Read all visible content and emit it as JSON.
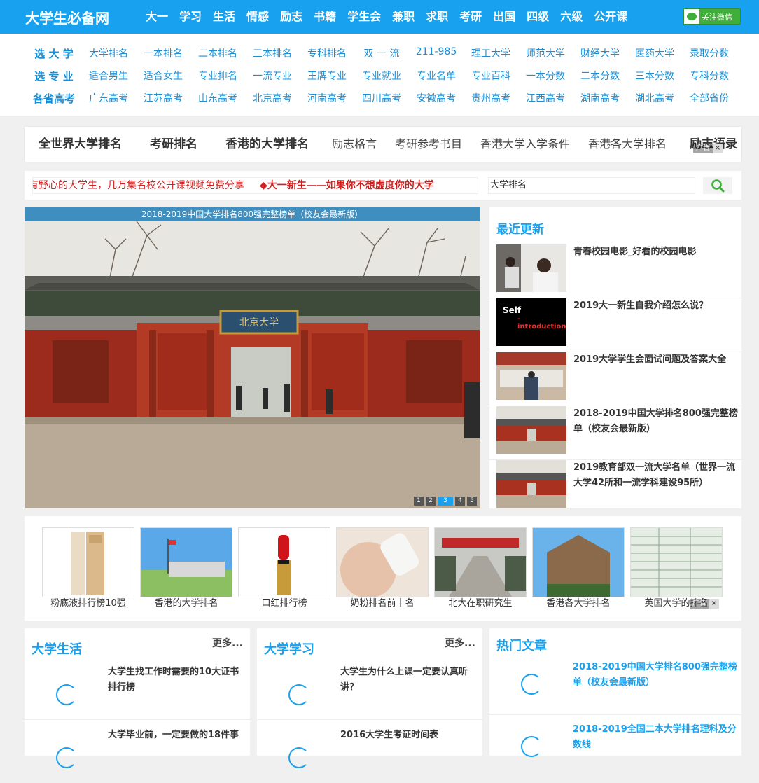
{
  "header": {
    "logo": "大学生必备网",
    "nav": [
      "大一",
      "学习",
      "生活",
      "情感",
      "励志",
      "书籍",
      "学生会",
      "兼职",
      "求职",
      "考研",
      "出国",
      "四级",
      "六级",
      "公开课"
    ],
    "wechat_label": "关注微信"
  },
  "link_grid": [
    [
      "选 大 学",
      "大学排名",
      "一本排名",
      "二本排名",
      "三本排名",
      "专科排名",
      "双 一 流",
      "211-985",
      "理工大学",
      "师范大学",
      "财经大学",
      "医药大学",
      "录取分数"
    ],
    [
      "选 专 业",
      "适合男生",
      "适合女生",
      "专业排名",
      "一流专业",
      "王牌专业",
      "专业就业",
      "专业名单",
      "专业百科",
      "一本分数",
      "二本分数",
      "三本分数",
      "专科分数"
    ],
    [
      "各省高考",
      "广东高考",
      "江苏高考",
      "山东高考",
      "北京高考",
      "河南高考",
      "四川高考",
      "安徽高考",
      "贵州高考",
      "江西高考",
      "湖南高考",
      "湖北高考",
      "全部省份"
    ]
  ],
  "ad_tabs": [
    "全世界大学排名",
    "考研排名",
    "香港的大学排名",
    "励志格言",
    "考研参考书目",
    "香港大学入学条件",
    "香港各大学排名",
    "励志语录"
  ],
  "ad_label": "广告",
  "ad_close": "×",
  "notice": {
    "text1": "有野心的大学生，几万集名校公开课视频免费分享",
    "text2": "◆大一新生——如果你不想虚度你的大学"
  },
  "search": {
    "value": "大学排名"
  },
  "slider": {
    "caption": "2018-2019中国大学排名800强完整榜单（校友会最新版）",
    "plaque": "北京大学",
    "dots": [
      "1",
      "2",
      "3",
      "4",
      "5"
    ],
    "active_dot": 3
  },
  "recent": {
    "title": "最近更新",
    "items": [
      "青春校园电影_好看的校园电影",
      "2019大一新生自我介绍怎么说？",
      "2019大学学生会面试问题及答案大全",
      "2018-2019中国大学排名800强完整榜单（校友会最新版）",
      "2019教育部双一流大学名单（世界一流大学42所和一流学科建设95所）"
    ],
    "thumb2_title": "Self",
    "thumb2_sub": "-introduction"
  },
  "strip": [
    "粉底液排行榜10强",
    "香港的大学排名",
    "口红排行榜",
    "奶粉排名前十名",
    "北大在职研究生",
    "香港各大学排名",
    "英国大学的排名"
  ],
  "columns": [
    {
      "title": "大学生活",
      "more": "更多...",
      "items": [
        "大学生找工作时需要的10大证书排行榜",
        "大学毕业前，一定要做的18件事"
      ]
    },
    {
      "title": "大学学习",
      "more": "更多...",
      "items": [
        "大学生为什么上课一定要认真听讲？",
        "2016大学生考证时间表"
      ]
    },
    {
      "title": "热门文章",
      "more": "",
      "items": [
        "2018-2019中国大学排名800强完整榜单（校友会最新版）",
        "2018-2019全国二本大学排名理科及分数线"
      ]
    }
  ],
  "colors": {
    "brand": "#18a1ef",
    "link": "#1a8fd6",
    "notice_red": "#d02020",
    "wechat_green": "#3fae3a"
  }
}
